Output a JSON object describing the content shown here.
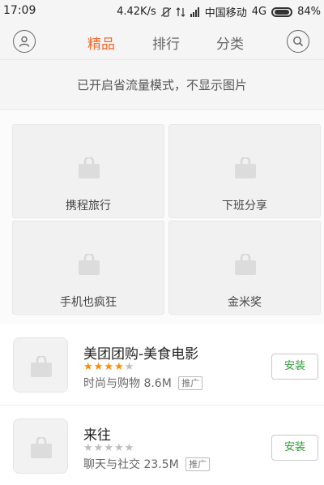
{
  "status_bar": {
    "time": "17:09",
    "speed": "4.42K/s",
    "carrier": "中国移动",
    "network": "4G",
    "battery": "84%"
  },
  "header": {
    "tabs": [
      {
        "label": "精品",
        "active": true
      },
      {
        "label": "排行",
        "active": false
      },
      {
        "label": "分类",
        "active": false
      }
    ],
    "accent_color": "#f06a2a"
  },
  "notice": {
    "text": "已开启省流量模式，不显示图片"
  },
  "grid": {
    "items": [
      {
        "label": "携程旅行",
        "icon": "bag-placeholder-icon"
      },
      {
        "label": "下班分享",
        "icon": "bag-placeholder-icon"
      },
      {
        "label": "手机也疯狂",
        "icon": "bag-placeholder-icon"
      },
      {
        "label": "金米奖",
        "icon": "bag-placeholder-icon"
      }
    ]
  },
  "apps": [
    {
      "name": "美团团购-美食电影",
      "rating": 4,
      "rating_max": 5,
      "category": "时尚与购物",
      "size": "8.6M",
      "badge": "推广",
      "button": "安装"
    },
    {
      "name": "来往",
      "rating": 0,
      "rating_max": 5,
      "category": "聊天与社交",
      "size": "23.5M",
      "badge": "推广",
      "button": "安装"
    }
  ]
}
